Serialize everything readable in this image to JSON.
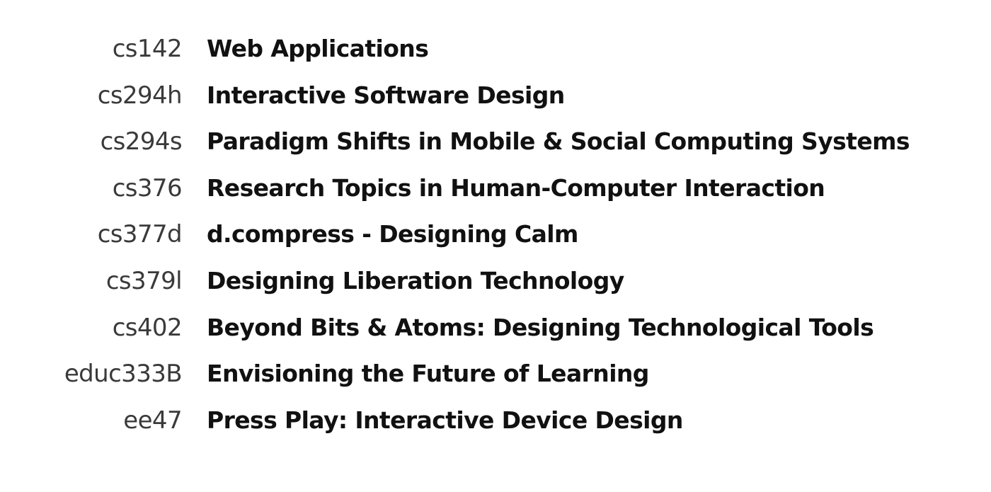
{
  "courses": [
    {
      "code": "cs142",
      "title": "Web Applications"
    },
    {
      "code": "cs294h",
      "title": "Interactive Software Design"
    },
    {
      "code": "cs294s",
      "title": "Paradigm Shifts in Mobile & Social Computing Systems"
    },
    {
      "code": "cs376",
      "title": "Research Topics in Human-Computer Interaction"
    },
    {
      "code": "cs377d",
      "title": "d.compress - Designing Calm"
    },
    {
      "code": "cs379l",
      "title": "Designing Liberation Technology"
    },
    {
      "code": "cs402",
      "title": "Beyond Bits & Atoms: Designing Technological Tools"
    },
    {
      "code": "educ333B",
      "title": "Envisioning the Future of Learning"
    },
    {
      "code": "ee47",
      "title": "Press Play: Interactive Device Design"
    }
  ]
}
